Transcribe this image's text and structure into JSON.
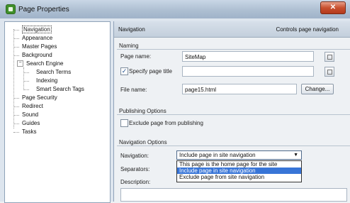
{
  "window": {
    "title": "Page Properties",
    "close_label": "✕"
  },
  "tree": {
    "items": [
      {
        "label": "Navigation"
      },
      {
        "label": "Appearance"
      },
      {
        "label": "Master Pages"
      },
      {
        "label": "Background"
      },
      {
        "label": "Search Engine",
        "expander": "−"
      },
      {
        "label": "Search Terms"
      },
      {
        "label": "Indexing"
      },
      {
        "label": "Smart Search Tags"
      },
      {
        "label": "Page Security"
      },
      {
        "label": "Redirect"
      },
      {
        "label": "Sound"
      },
      {
        "label": "Guides"
      },
      {
        "label": "Tasks"
      }
    ]
  },
  "header": {
    "title": "Navigation",
    "description": "Controls page navigation"
  },
  "naming": {
    "section_title": "Naming",
    "page_name_label": "Page name:",
    "page_name_value": "SiteMap",
    "specify_title_label": "Specify page title",
    "specify_title_checked": "✓",
    "page_title_value": "",
    "file_name_label": "File name:",
    "file_name_value": "page15.html",
    "change_button": "Change..."
  },
  "publishing": {
    "section_title": "Publishing Options",
    "exclude_label": "Exclude page from publishing"
  },
  "navigation_options": {
    "section_title": "Navigation Options",
    "navigation_label": "Navigation:",
    "navigation_selected": "Include page in site navigation",
    "navigation_arrow": "▼",
    "options": [
      "This page is the home page for the site",
      "Include page in site navigation",
      "Exclude page from site navigation"
    ],
    "separators_label": "Separators:",
    "description_label": "Description:"
  }
}
